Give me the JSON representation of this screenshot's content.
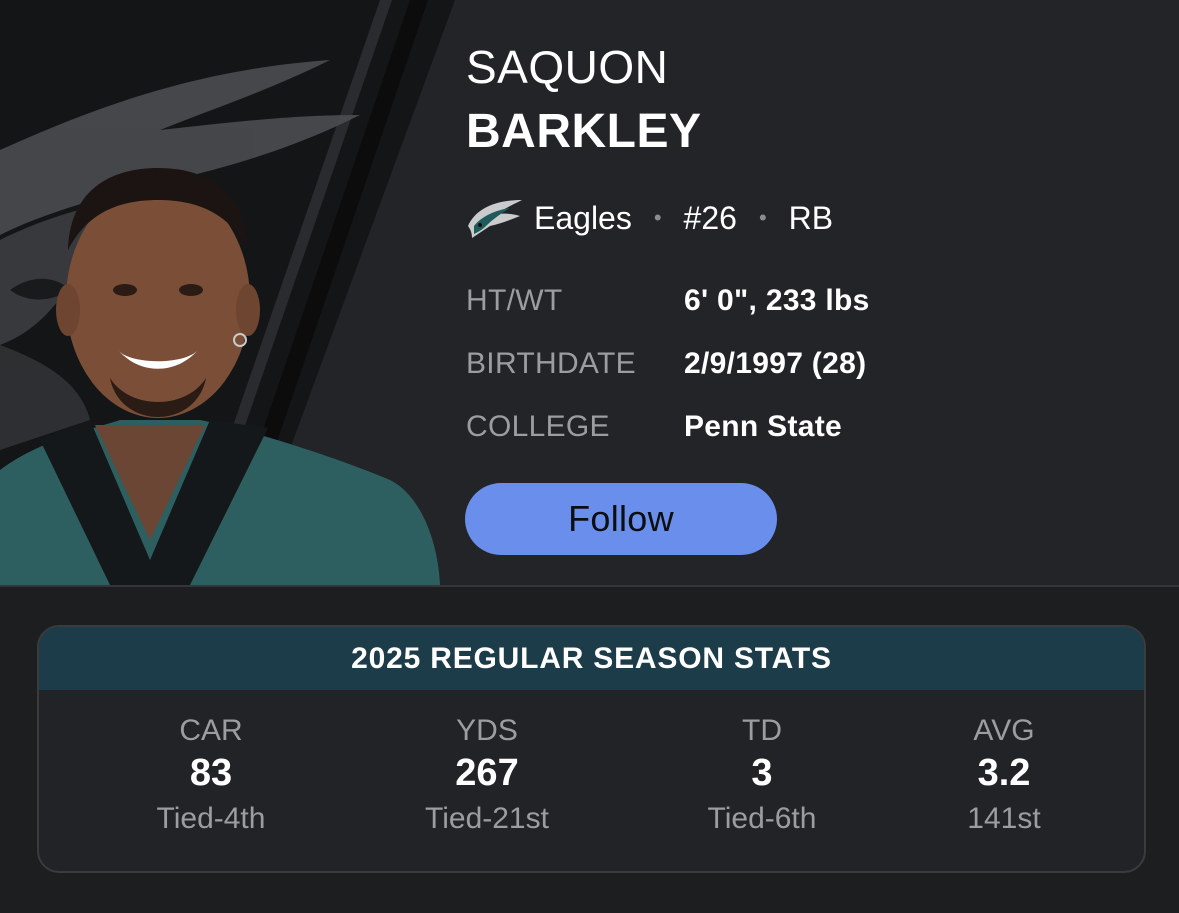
{
  "player": {
    "first_name": "SAQUON",
    "last_name": "BARKLEY",
    "team": "Eagles",
    "number": "#26",
    "position": "RB",
    "separator": "•"
  },
  "bio": [
    {
      "label": "HT/WT",
      "value": "6' 0\", 233 lbs"
    },
    {
      "label": "BIRTHDATE",
      "value": "2/9/1997 (28)"
    },
    {
      "label": "COLLEGE",
      "value": "Penn State"
    }
  ],
  "follow_label": "Follow",
  "stats": {
    "title": "2025 REGULAR SEASON STATS",
    "columns": [
      {
        "label": "CAR",
        "value": "83",
        "rank": "Tied-4th"
      },
      {
        "label": "YDS",
        "value": "267",
        "rank": "Tied-21st"
      },
      {
        "label": "TD",
        "value": "3",
        "rank": "Tied-6th"
      },
      {
        "label": "AVG",
        "value": "3.2",
        "rank": "141st"
      }
    ]
  },
  "colors": {
    "background": "#1d1e20",
    "header": "#232427",
    "accent_button": "#6a8eeb",
    "stats_header": "#1c3c49",
    "eagles_green": "#1f5b5c"
  },
  "icons": {
    "team_logo": "eagles-logo-icon"
  }
}
